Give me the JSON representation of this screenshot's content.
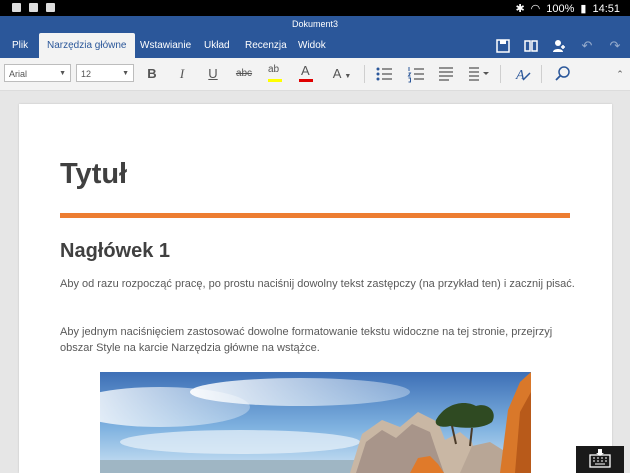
{
  "status": {
    "battery": "100%",
    "time": "14:51"
  },
  "window": {
    "doc_name": "Dokument3"
  },
  "tabs": [
    {
      "label": "Plik"
    },
    {
      "label": "Narzędzia główne"
    },
    {
      "label": "Wstawianie"
    },
    {
      "label": "Układ"
    },
    {
      "label": "Recenzja"
    },
    {
      "label": "Widok"
    }
  ],
  "toolbar": {
    "font": "Arial",
    "size": "12",
    "bold": "B",
    "italic": "I",
    "underline": "U",
    "strike": "abc",
    "highlight": "ab",
    "font_color": "A",
    "text_size": "A"
  },
  "colors": {
    "accent": "#2b579a",
    "orange_rule": "#ed7d31",
    "highlight": "#ffff00",
    "font_red": "#e00000"
  },
  "document": {
    "title": "Tytuł",
    "heading": "Nagłówek 1",
    "para1": "Aby od razu rozpocząć pracę, po prostu naciśnij dowolny tekst zastępczy (na przykład ten) i zacznij pisać.",
    "para2": "Aby jednym naciśnięciem zastosować dowolne formatowanie tekstu widoczne na tej stronie, przejrzyj obszar Style na karcie Narzędzia główne na wstążce."
  }
}
